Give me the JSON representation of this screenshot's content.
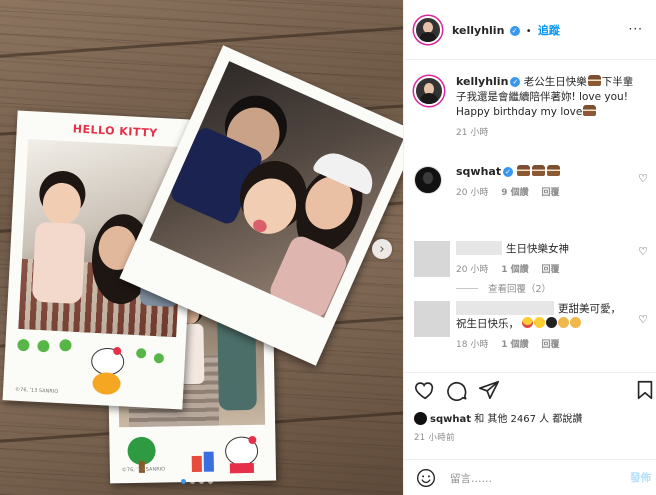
{
  "photo": {
    "left_polaroid_brand": "HELLO KITTY",
    "left_polaroid_footer": "©76, '13 SANRIO",
    "bottom_polaroid_footer": "©76, '13 SANRIO",
    "carousel_index": 1,
    "carousel_count": 4
  },
  "header": {
    "username": "kellyhlin",
    "follow_label": "追蹤",
    "more": "···"
  },
  "caption": {
    "username": "kellyhlin",
    "text_1": "老公生日快樂",
    "text_2": "下半輩子我還是會繼續陪伴著妳! love you! Happy birthday my love",
    "time": "21 小時"
  },
  "comments": [
    {
      "username": "sqwhat",
      "time": "20 小時",
      "likes": "9 個讚",
      "reply": "回覆"
    },
    {
      "text": "生日快樂女神",
      "time": "20 小時",
      "likes": "1 個讚",
      "reply": "回覆"
    },
    {
      "text_1": "更甜美可愛，",
      "text_2": "祝生日快乐，",
      "time": "18 小時",
      "likes": "1 個讚",
      "reply": "回覆"
    }
  ],
  "view_replies": "查看回覆（2）",
  "actions": {
    "liker": "sqwhat",
    "likes_text": "和 其他 2467 人 都說讚",
    "time": "21 小時前"
  },
  "composer": {
    "placeholder": "留言……",
    "post_label": "發佈"
  },
  "colors": {
    "accent": "#0095f6",
    "verified": "#3897f0",
    "muted": "#8e8e8e"
  }
}
